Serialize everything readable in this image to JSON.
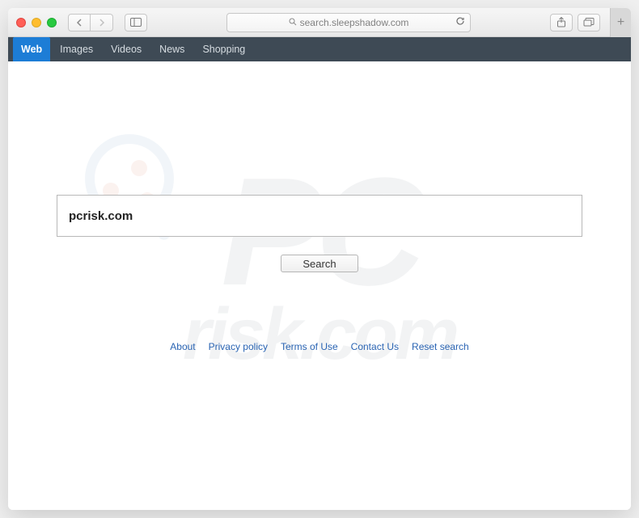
{
  "browser": {
    "address": "search.sleepshadow.com"
  },
  "tabs": {
    "items": [
      {
        "label": "Web",
        "active": true
      },
      {
        "label": "Images"
      },
      {
        "label": "Videos"
      },
      {
        "label": "News"
      },
      {
        "label": "Shopping"
      }
    ]
  },
  "search": {
    "value": "pcrisk.com",
    "button_label": "Search"
  },
  "footer": {
    "links": [
      {
        "label": "About"
      },
      {
        "label": "Privacy policy"
      },
      {
        "label": "Terms of Use"
      },
      {
        "label": "Contact Us"
      },
      {
        "label": "Reset search"
      }
    ]
  },
  "watermark": {
    "top": "PC",
    "bottom": "risk.com"
  }
}
